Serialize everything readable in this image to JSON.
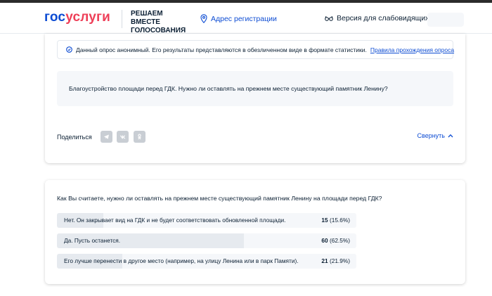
{
  "header": {
    "logo_gos": "гос",
    "logo_uslugi": "услуги",
    "project_title": "РЕШАЕМ ВМЕСТЕ ГОЛОСОВАНИЯ",
    "address_label": "Адрес регистрации",
    "vision_label": "Версия для слабовидящих"
  },
  "notice": {
    "text": "Данный опрос анонимный. Его результаты представляются в обезличенном виде в формате статистики.",
    "link": "Правила прохождения опроса"
  },
  "poll": {
    "question": "Благоустройство площади перед ГДК. Нужно ли оставлять на прежнем месте существующий памятник Ленину?"
  },
  "share": {
    "label": "Поделиться",
    "collapse_label": "Свернуть",
    "buttons": [
      "telegram-icon",
      "vk-icon",
      "odnoklassniki-icon"
    ]
  },
  "results": {
    "question": "Как Вы считаете, нужно ли оставлять на прежнем месте существующий памятник Ленину на площади перед ГДК?",
    "answers": [
      {
        "text": "Нет. Он закрывает вид на ГДК и не будет соответствовать обновленной площади.",
        "count": "15",
        "percent": "(15.6%)",
        "share": 0.156
      },
      {
        "text": "Да. Пусть останется.",
        "count": "60",
        "percent": "(62.5%)",
        "share": 0.625
      },
      {
        "text": "Его лучше перенести в другое место (например, на улицу Ленина или в парк Памяти).",
        "count": "21",
        "percent": "(21.9%)",
        "share": 0.219
      }
    ]
  },
  "colors": {
    "brand_blue": "#0d4cd3",
    "brand_red": "#ee3f58",
    "text": "#0b1f33",
    "panel_bg": "#f5f7fa",
    "bar_fill": "#e6eaef"
  }
}
